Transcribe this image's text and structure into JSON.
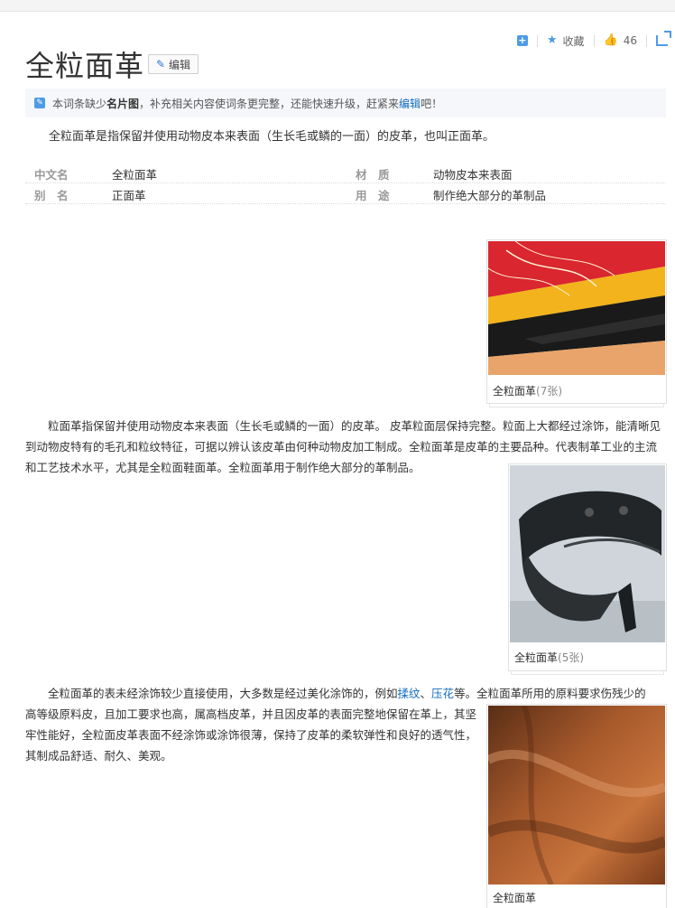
{
  "page": {
    "title": "全粒面革",
    "edit_label": "编辑"
  },
  "actions": {
    "favorite_label": "收藏",
    "like_count": "46"
  },
  "notice": {
    "text_before": "本词条缺少",
    "missing": "名片图",
    "text_mid": "，补充相关内容使词条更完整，还能快速升级，赶紧来",
    "edit_link": "编辑",
    "text_end": "吧！"
  },
  "summary": "全粒面革是指保留并使用动物皮本来表面（生长毛或鳞的一面）的皮革，也叫正面革。",
  "basic_info": [
    {
      "key": "中文名",
      "value": "全粒面革"
    },
    {
      "key": "材　质",
      "value": "动物皮本来表面"
    },
    {
      "key": "别　名",
      "value": "正面革"
    },
    {
      "key": "用　途",
      "value": "制作绝大部分的革制品"
    }
  ],
  "paragraphs": {
    "p1": "粒面革指保留并使用动物皮本来表面（生长毛或鳞的一面）的皮革。 皮革粒面层保持完整。粒面上大都经过涂饰，能清晰见到动物皮特有的毛孔和粒纹特征，可据以辨认该皮革由何种动物皮加工制成。全粒面革是皮革的主要品种。代表制革工业的主流和工艺技术水平，尤其是全粒面鞋面革。全粒面革用于制作绝大部分的革制品。",
    "p2_a": "全粒面革的表未经涂饰较少直接使用，大多数是经过美化涂饰的，例如",
    "p2_link1": "揉纹",
    "p2_sep": "、",
    "p2_link2": "压花",
    "p2_b": "等。全粒面革所用的原料要求伤残少的高等级原料皮，且加工要求也高，属高档皮革，并且因皮革的表面完整地保留在革上，其坚牢性能好，全粒面皮革表面不经涂饰或涂饰很薄，保持了皮革的柔软弹性和良好的透气性，其制成品舒适、耐久、美观。"
  },
  "figures": [
    {
      "caption": "全粒面革",
      "count": "(7张)"
    },
    {
      "caption": "全粒面革",
      "count": "(5张)"
    },
    {
      "caption": "全粒面革",
      "count": ""
    }
  ]
}
